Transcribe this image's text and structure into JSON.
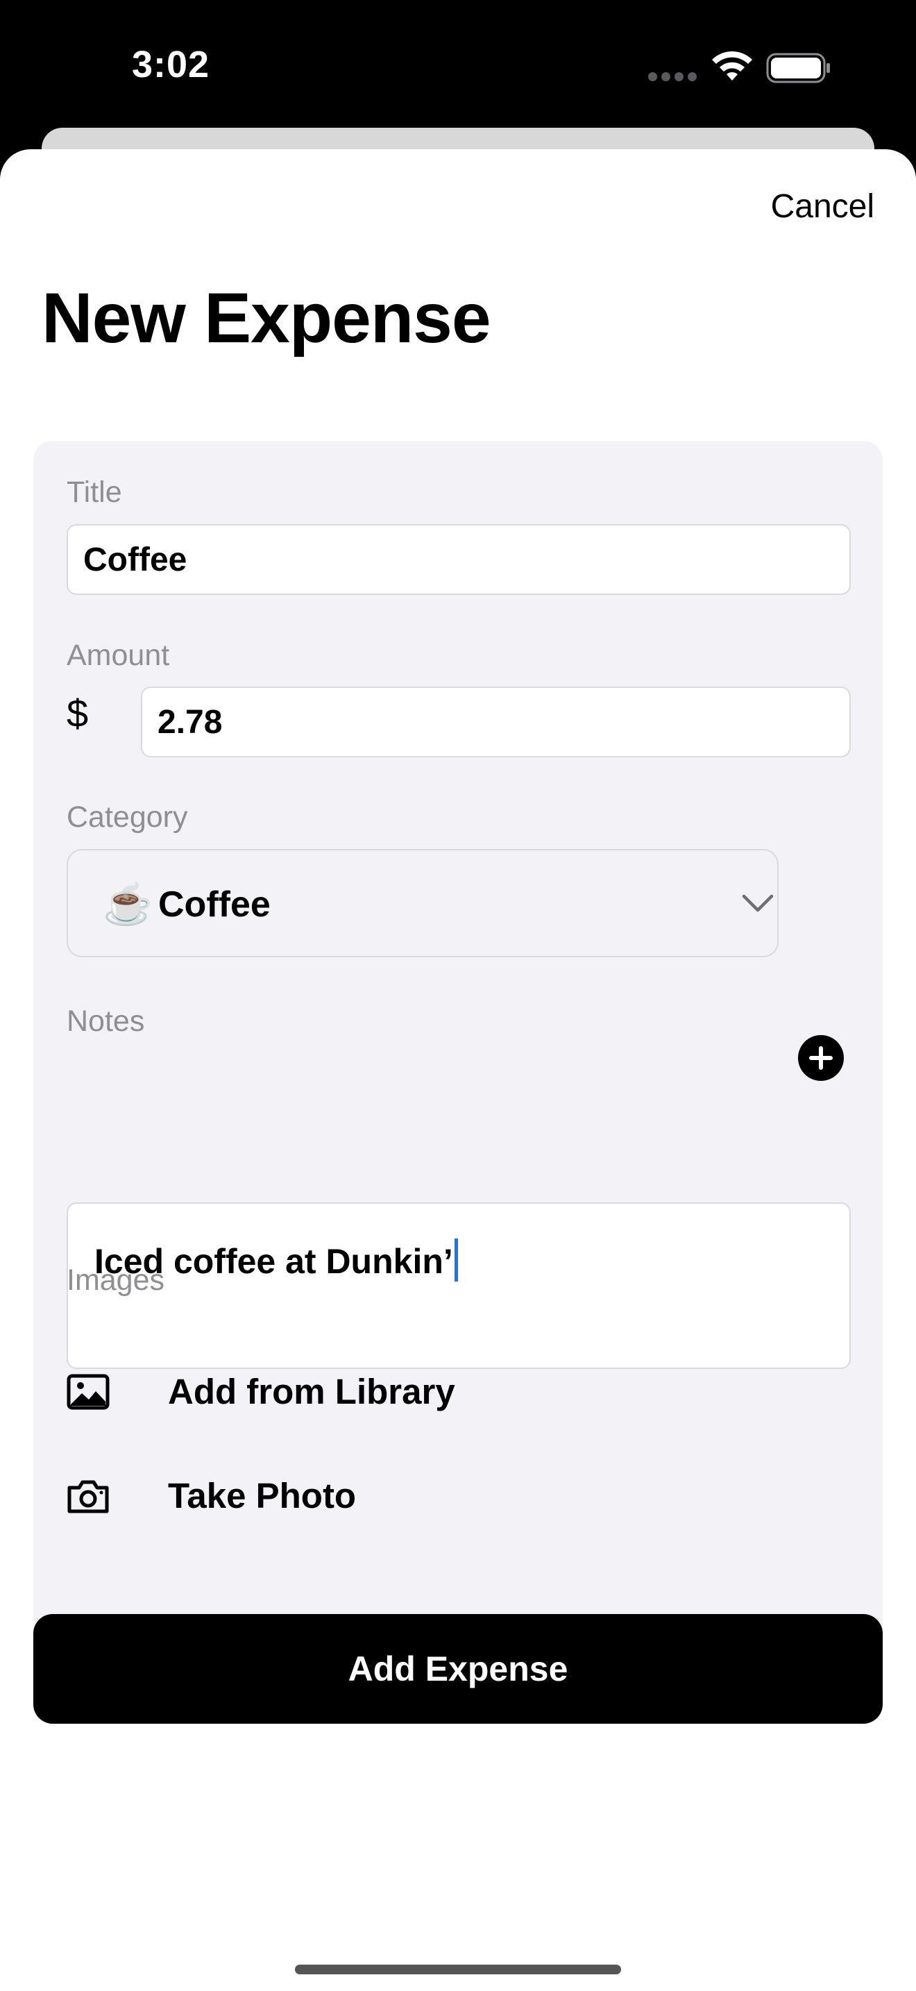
{
  "status_bar": {
    "time": "3:02",
    "icons": [
      "cellular-dots-icon",
      "wifi-icon",
      "battery-icon"
    ]
  },
  "header": {
    "cancel_label": "Cancel",
    "title": "New Expense"
  },
  "form": {
    "title_label": "Title",
    "title_value": "Coffee",
    "amount_label": "Amount",
    "currency_symbol": "$",
    "amount_value": "2.78",
    "category_label": "Category",
    "category_emoji": "☕️",
    "category_value": "Coffee",
    "notes_label": "Notes",
    "notes_value": "Iced coffee at Dunkin’",
    "images_label": "Images",
    "add_from_library_label": "Add from Library",
    "take_photo_label": "Take Photo"
  },
  "primary_action": {
    "label": "Add Expense"
  },
  "colors": {
    "card_background": "#f2f2f7",
    "label_gray": "#8e8e93",
    "caret_blue": "#1a73e8",
    "button_black": "#000000"
  }
}
